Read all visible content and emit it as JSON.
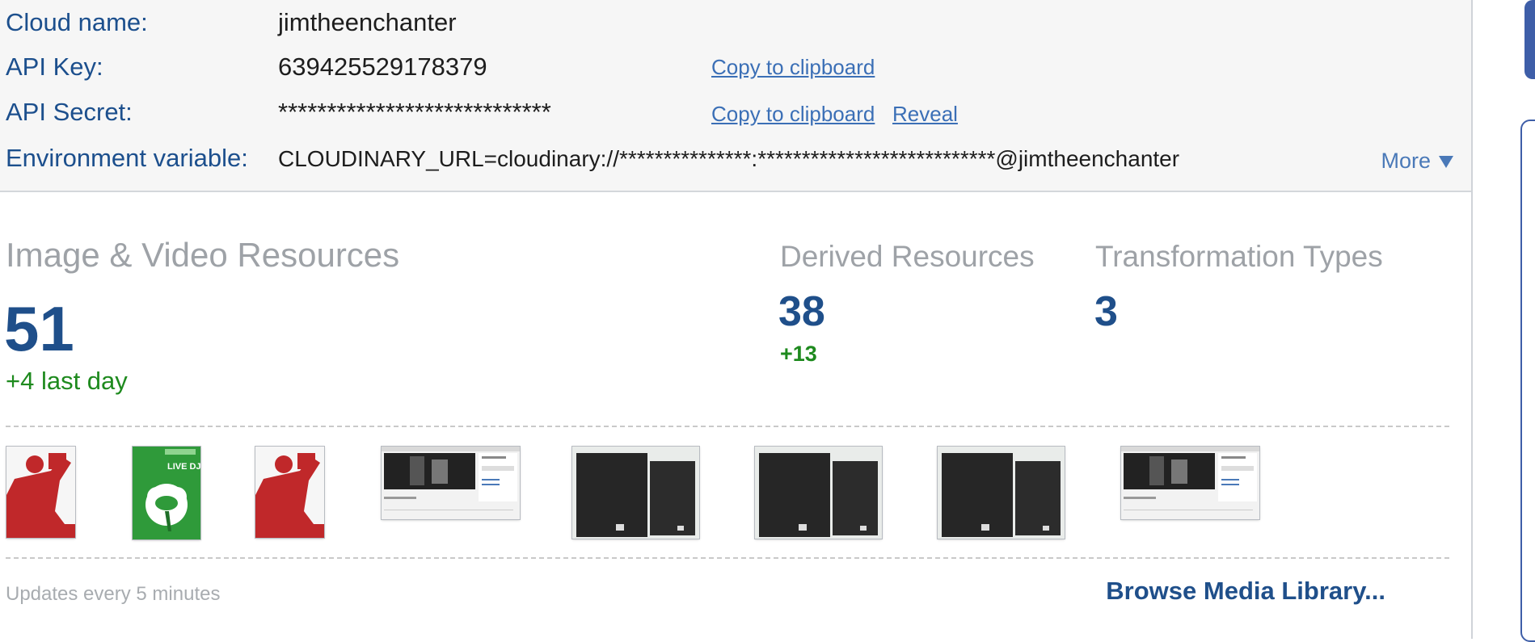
{
  "credentials": {
    "cloud_name": {
      "label": "Cloud name:",
      "value": "jimtheenchanter"
    },
    "api_key": {
      "label": "API Key:",
      "value": "639425529178379",
      "copy_label": "Copy to clipboard"
    },
    "api_secret": {
      "label": "API Secret:",
      "value": "****************************",
      "copy_label": "Copy to clipboard",
      "reveal_label": "Reveal"
    },
    "env_var": {
      "label": "Environment variable:",
      "value": "CLOUDINARY_URL=cloudinary://***************:***************************@jimtheenchanter"
    },
    "more_label": "More"
  },
  "stats": {
    "resources": {
      "title": "Image & Video Resources",
      "count": "51",
      "delta": "+4 last day"
    },
    "derived": {
      "title": "Derived Resources",
      "count": "38",
      "delta": "+13"
    },
    "transformations": {
      "title": "Transformation Types",
      "count": "3"
    }
  },
  "thumbnails": [
    {
      "kind": "red-figure"
    },
    {
      "kind": "green-poster",
      "text": "LIVE DJ'S"
    },
    {
      "kind": "red-figure"
    },
    {
      "kind": "webpage-screenshot"
    },
    {
      "kind": "speakers"
    },
    {
      "kind": "speakers"
    },
    {
      "kind": "speakers"
    },
    {
      "kind": "webpage-screenshot"
    }
  ],
  "footer": {
    "update_note": "Updates every 5 minutes",
    "browse_label": "Browse Media Library..."
  },
  "colors": {
    "label_blue": "#1c4f8d",
    "link_blue": "#3b6fb6",
    "stat_blue": "#1f4f8a",
    "delta_green": "#1e8a1e"
  }
}
